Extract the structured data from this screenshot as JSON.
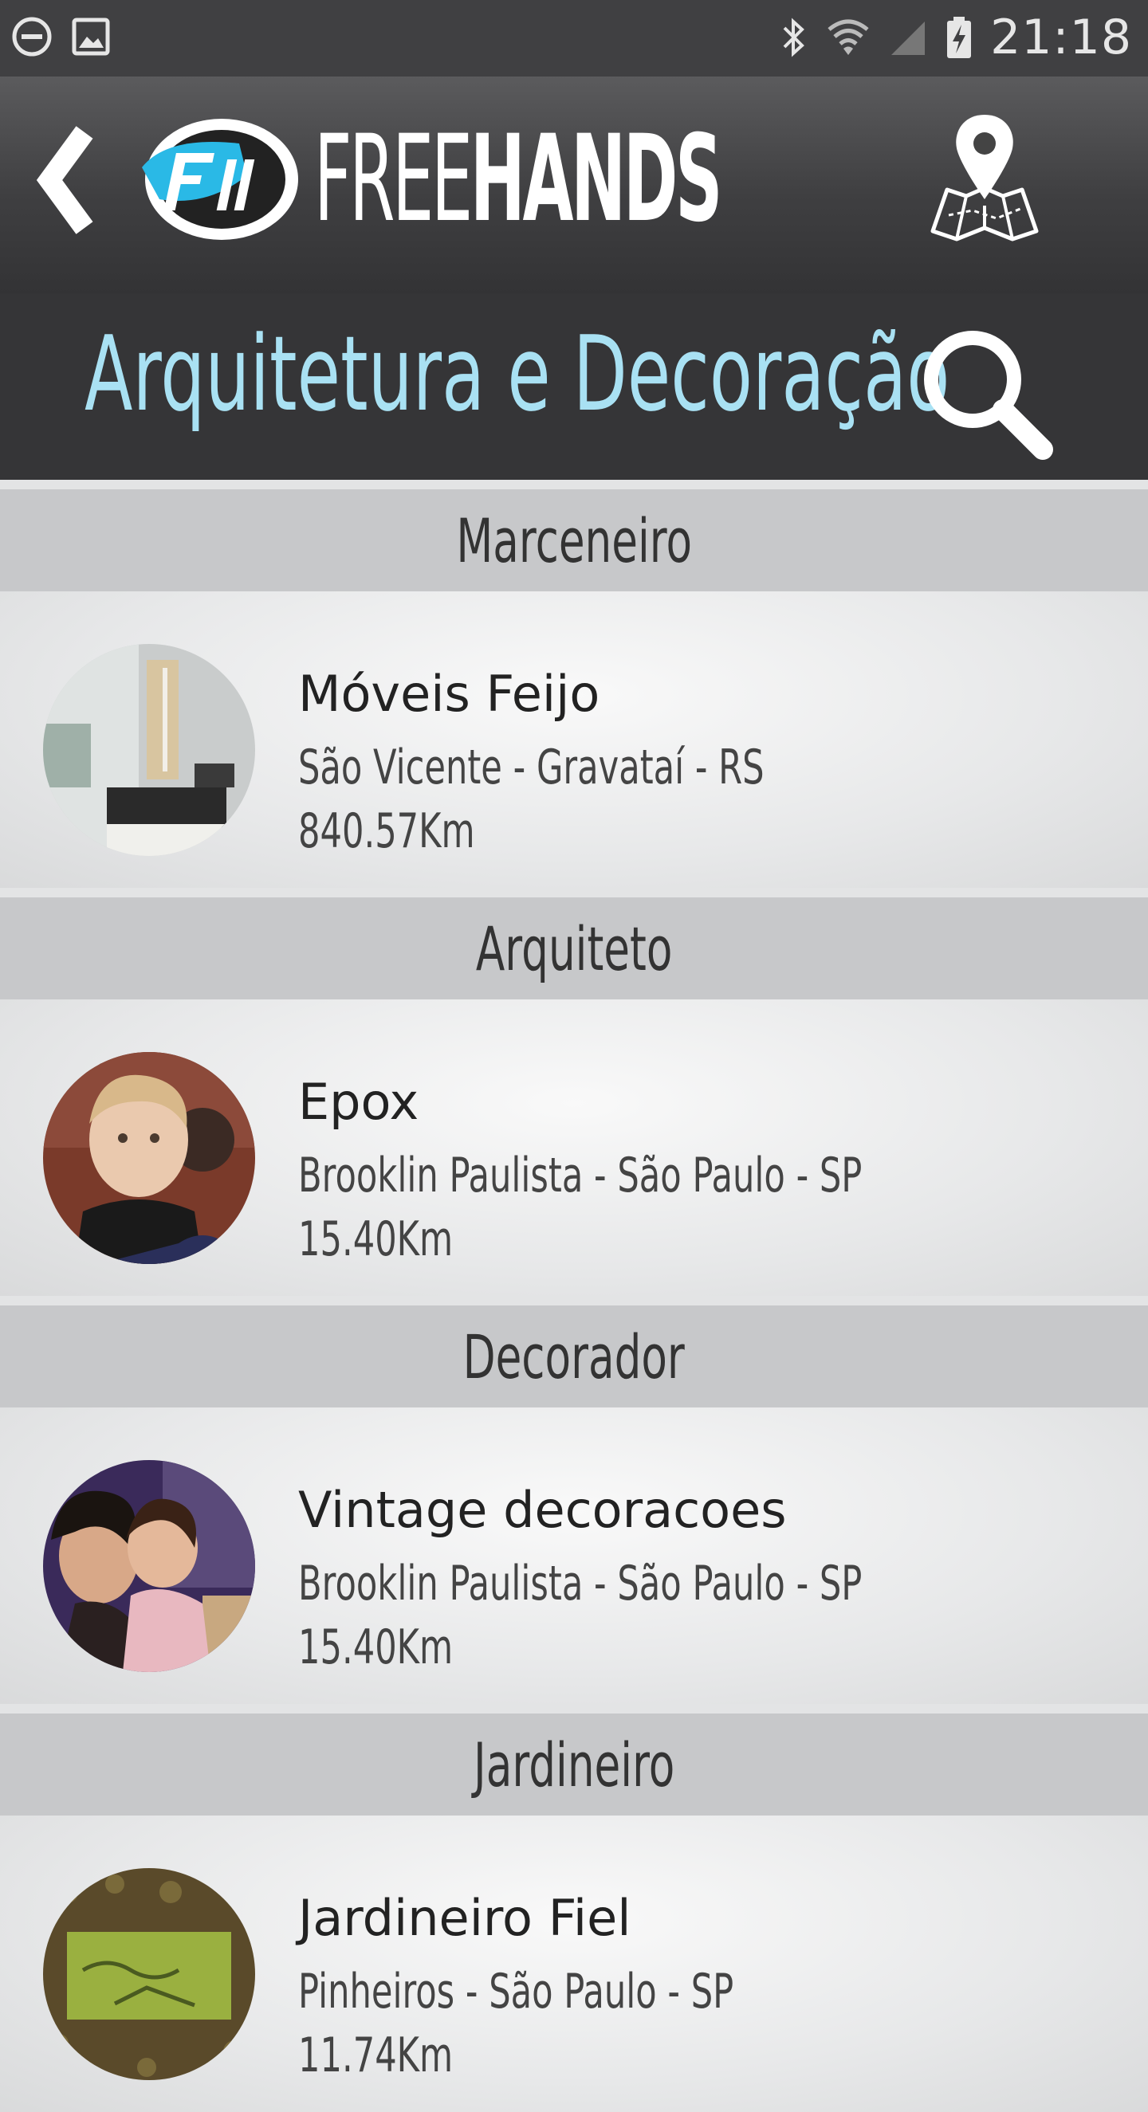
{
  "status_bar": {
    "time": "21:18",
    "icons": [
      "dnd-icon",
      "image-icon",
      "bluetooth-icon",
      "wifi-icon",
      "signal-icon",
      "battery-charging-icon"
    ]
  },
  "toolbar": {
    "logo_light": "FREE",
    "logo_bold": "HANDS",
    "brand_color": "#2ab9e6"
  },
  "title_bar": {
    "title": "Arquitetura e Decoração",
    "title_color": "#a9e1f3"
  },
  "sections": [
    {
      "header": "Marceneiro",
      "item": {
        "name": "Móveis Feijo",
        "address": "São Vicente - Gravataí - RS",
        "distance": "840.57Km"
      }
    },
    {
      "header": "Arquiteto",
      "item": {
        "name": "Epox",
        "address": "Brooklin Paulista - São Paulo - SP",
        "distance": "15.40Km"
      }
    },
    {
      "header": "Decorador",
      "item": {
        "name": "Vintage decoracoes",
        "address": "Brooklin Paulista - São Paulo - SP",
        "distance": "15.40Km"
      }
    },
    {
      "header": "Jardineiro",
      "item": {
        "name": "Jardineiro Fiel",
        "address": "Pinheiros - São Paulo - SP",
        "distance": "11.74Km"
      }
    }
  ]
}
